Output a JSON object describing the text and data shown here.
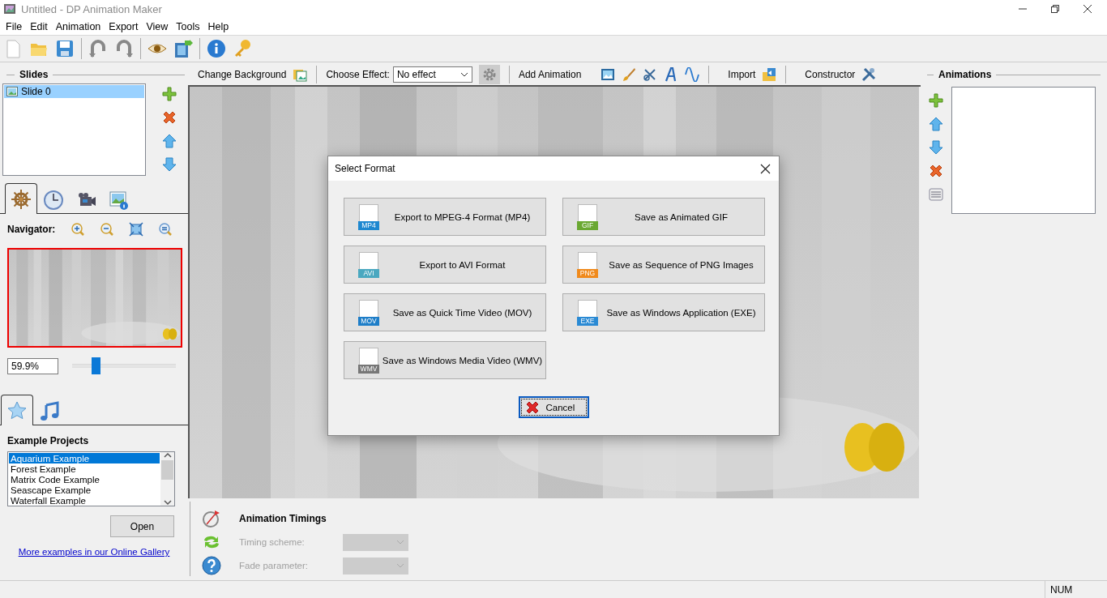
{
  "window": {
    "title": "Untitled - DP Animation Maker"
  },
  "menu": [
    {
      "label": "File"
    },
    {
      "label": "Edit"
    },
    {
      "label": "Animation"
    },
    {
      "label": "Export"
    },
    {
      "label": "View"
    },
    {
      "label": "Tools"
    },
    {
      "label": "Help"
    }
  ],
  "slides": {
    "title": "Slides",
    "items": [
      {
        "label": "Slide 0",
        "selected": true
      }
    ]
  },
  "view_tabs": [
    {
      "kind": "helm",
      "selected": true
    },
    {
      "kind": "clock",
      "selected": false
    },
    {
      "kind": "camera",
      "selected": false
    },
    {
      "kind": "image-info",
      "selected": false
    }
  ],
  "navigator": {
    "label": "Navigator:",
    "zoom": "59.9%",
    "level": 0.23
  },
  "library_tabs": [
    {
      "kind": "star",
      "selected": true
    },
    {
      "kind": "music",
      "selected": false
    }
  ],
  "examples": {
    "title": "Example Projects",
    "items": [
      {
        "label": "Aquarium Example",
        "selected": true
      },
      {
        "label": "Forest Example",
        "selected": false
      },
      {
        "label": "Matrix Code Example",
        "selected": false
      },
      {
        "label": "Seascape Example",
        "selected": false
      },
      {
        "label": "Waterfall Example",
        "selected": false
      }
    ],
    "open_button": "Open",
    "gallery_link": "More examples in our Online Gallery"
  },
  "effects_bar": {
    "change_background": "Change Background",
    "choose_effect_label": "Choose Effect:",
    "effect": "No effect",
    "add_animation": "Add Animation",
    "import": "Import",
    "constructor": "Constructor"
  },
  "timings": {
    "title": "Animation Timings",
    "fields": [
      {
        "label": "Timing scheme:",
        "disabled": true
      },
      {
        "label": "Fade parameter:",
        "disabled": true
      }
    ]
  },
  "animations": {
    "title": "Animations"
  },
  "dialog": {
    "title": "Select Format",
    "formats": [
      {
        "label": "Export to MPEG-4 Format (MP4)",
        "badge": "MP4",
        "color": "#1e88d0"
      },
      {
        "label": "Save as Animated GIF",
        "badge": "GIF",
        "color": "#6aa832"
      },
      {
        "label": "Export to AVI Format",
        "badge": "AVI",
        "color": "#4aa8c0"
      },
      {
        "label": "Save as Sequence of PNG Images",
        "badge": "PNG",
        "color": "#f08a1c"
      },
      {
        "label": "Save as Quick Time Video (MOV)",
        "badge": "MOV",
        "color": "#1e7ec8"
      },
      {
        "label": "Save as Windows Application (EXE)",
        "badge": "EXE",
        "color": "#2a8ad4"
      },
      {
        "label": "Save as Windows Media Video (WMV)",
        "badge": "WMV",
        "color": "#777777"
      }
    ],
    "cancel": "Cancel"
  },
  "status_bar": {
    "num": "NUM"
  }
}
